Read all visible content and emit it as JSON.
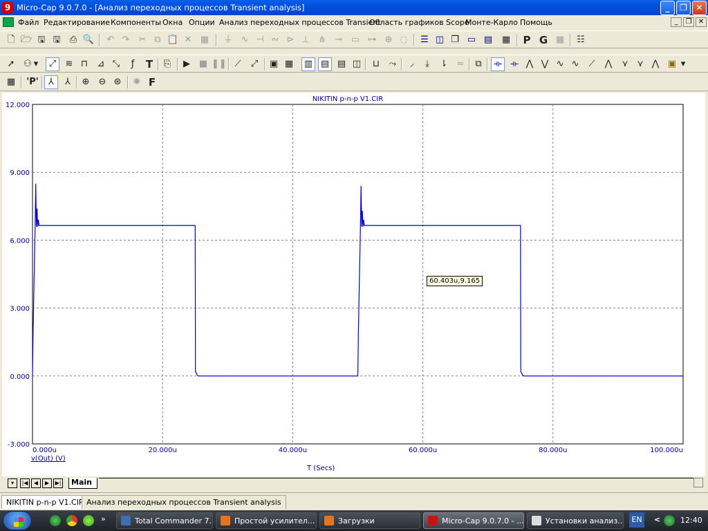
{
  "window": {
    "title": "Micro-Cap 9.0.7.0 - [Анализ переходных процессов Transient analysis]",
    "app_icon": "9",
    "controls": [
      "_",
      "❐",
      "✕"
    ]
  },
  "menu": {
    "items": [
      "Файл",
      "Редактирование",
      "Компоненты",
      "Окна",
      "Опции",
      "Анализ переходных процессов Transient",
      "Область графиков Scope",
      "Монте-Карло",
      "Помощь"
    ],
    "mdi_controls": [
      "_",
      "❐",
      "✕"
    ]
  },
  "toolbar3": {
    "p_label": "'P'",
    "f_label": "F"
  },
  "plot": {
    "title": "NIKITIN p-n-p V1.CIR",
    "tooltip": "60.403u,9.165",
    "line_color": "#0000CC",
    "grid_color": "#808080"
  },
  "chart_data": {
    "type": "line",
    "title": "NIKITIN p-n-p V1.CIR",
    "xlabel": "T (Secs)",
    "ylabel": "v(Out) (V)",
    "xlim": [
      0,
      100
    ],
    "ylim": [
      -3,
      12
    ],
    "x_unit": "u",
    "xticks": [
      "0.000u",
      "20.000u",
      "40.000u",
      "60.000u",
      "80.000u",
      "100.000u"
    ],
    "yticks": [
      "12.000",
      "9.000",
      "6.000",
      "3.000",
      "0.000",
      "-3.000"
    ],
    "grid": true,
    "series": [
      {
        "name": "v(Out) (V)",
        "x": [
          0.0,
          0.1,
          0.4,
          0.5,
          0.6,
          0.7,
          0.8,
          0.9,
          1.0,
          25.0,
          25.05,
          25.3,
          25.5,
          50.0,
          50.1,
          50.4,
          50.5,
          50.6,
          50.7,
          50.8,
          50.9,
          51.0,
          75.0,
          75.05,
          75.3,
          75.5,
          100.0
        ],
        "y": [
          0.0,
          2.0,
          6.6,
          8.5,
          6.6,
          7.4,
          6.6,
          6.9,
          6.65,
          6.65,
          0.2,
          0.05,
          0.0,
          0.0,
          2.0,
          6.6,
          8.4,
          6.6,
          7.3,
          6.6,
          6.9,
          6.65,
          6.65,
          0.2,
          0.05,
          0.0,
          0.0
        ]
      }
    ]
  },
  "sheet": {
    "nav": [
      "▾",
      "|◀",
      "◀",
      "▶",
      "▶|"
    ],
    "tab": "Main"
  },
  "doc_tabs": [
    "NIKITIN p-n-p V1.CIR",
    "Анализ переходных процессов Transient analysis"
  ],
  "taskbar": {
    "expand": "»",
    "tasks": [
      {
        "label": "Total Commander 7....",
        "icon_color": "#3A6FB8"
      },
      {
        "label": "Простой усилител...",
        "icon_color": "#E8731A"
      },
      {
        "label": "Загрузки",
        "icon_color": "#E8731A"
      },
      {
        "label": "Micro-Cap 9.0.7.0 - ...",
        "icon_color": "#CC1111"
      },
      {
        "label": "Установки анализ...",
        "icon_color": "#DDDDDD"
      }
    ],
    "lang": "EN",
    "tray_arrow": "<",
    "clock": "12:40"
  }
}
